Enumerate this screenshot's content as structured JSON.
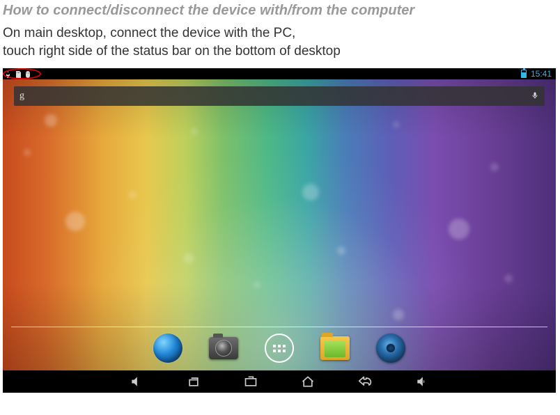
{
  "document": {
    "heading": "How to connect/disconnect the device with/from the computer",
    "body_line1": "On main desktop, connect the device with the PC,",
    "body_line2": "touch right side of the status bar on the bottom of desktop"
  },
  "android": {
    "status_bar": {
      "time": "15:41",
      "left_icons": [
        "usb-icon",
        "sd-card-icon",
        "debug-icon"
      ],
      "right_icons": [
        "battery-icon"
      ]
    },
    "search": {
      "provider_letter": "g",
      "mic": "mic-icon"
    },
    "dock": {
      "items": [
        {
          "name": "browser-app",
          "label": "Browser"
        },
        {
          "name": "camera-app",
          "label": "Camera"
        },
        {
          "name": "apps-drawer",
          "label": "Apps"
        },
        {
          "name": "file-manager-app",
          "label": "Files"
        },
        {
          "name": "music-app",
          "label": "Music"
        }
      ]
    },
    "nav_bar": {
      "items": [
        {
          "name": "volume-down-button",
          "icon": "volume-down-icon"
        },
        {
          "name": "recent-apps-button",
          "icon": "recent-icon"
        },
        {
          "name": "screenshot-button",
          "icon": "screenshot-icon"
        },
        {
          "name": "home-button",
          "icon": "home-icon"
        },
        {
          "name": "back-button",
          "icon": "back-icon"
        },
        {
          "name": "volume-up-button",
          "icon": "volume-up-icon"
        }
      ]
    }
  }
}
